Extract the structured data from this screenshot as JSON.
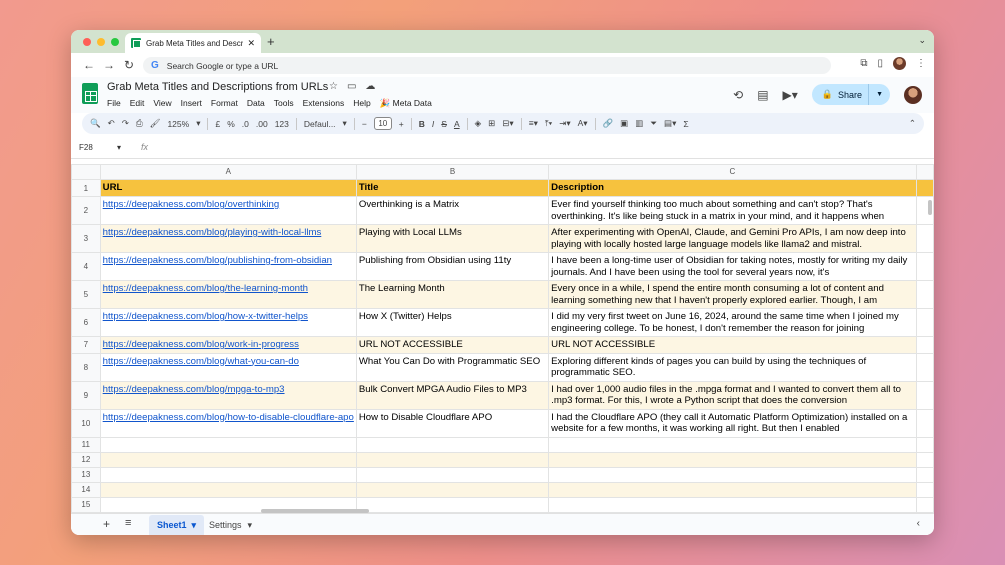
{
  "browser": {
    "tab_title": "Grab Meta Titles and Descriptio",
    "omnibox_placeholder": "Search Google or type a URL",
    "traffic_colors": [
      "#ff5f57",
      "#febc2e",
      "#28c840"
    ]
  },
  "app": {
    "doc_title": "Grab Meta Titles and Descriptions from URLs",
    "menu": [
      "File",
      "Edit",
      "View",
      "Insert",
      "Format",
      "Data",
      "Tools",
      "Extensions",
      "Help",
      "🎉 Meta Data"
    ],
    "share_label": "Share"
  },
  "toolbar": {
    "zoom": "125%",
    "currency": "£",
    "percent": "%",
    "dec_decrease": ".0",
    "dec_increase": ".00",
    "number_format": "123",
    "font": "Defaul...",
    "font_size": "10"
  },
  "formula": {
    "cell_ref": "F28",
    "fx": "fx"
  },
  "grid": {
    "columns": [
      "A",
      "B",
      "C"
    ],
    "header": {
      "url": "URL",
      "title": "Title",
      "description": "Description"
    },
    "rows": [
      {
        "n": "2",
        "url": "https://deepakness.com/blog/overthinking",
        "title": "Overthinking is a Matrix",
        "desc": "Ever find yourself thinking too much about something and can't stop? That's overthinking. It's like being stuck in a matrix in your mind, and it happens when"
      },
      {
        "n": "3",
        "url": "https://deepakness.com/blog/playing-with-local-llms",
        "title": "Playing with Local LLMs",
        "desc": "After experimenting with OpenAI, Claude, and Gemini Pro APIs, I am now deep into playing with locally hosted large language models like llama2 and mistral."
      },
      {
        "n": "4",
        "url": "https://deepakness.com/blog/publishing-from-obsidian",
        "title": "Publishing from Obsidian using 11ty",
        "desc": "I have been a long-time user of Obsidian for taking notes, mostly for writing my daily journals. And I have been using the tool for several years now, it's"
      },
      {
        "n": "5",
        "url": "https://deepakness.com/blog/the-learning-month",
        "title": "The Learning Month",
        "desc": "Every once in a while, I spend the entire month consuming a lot of content and learning something new that I haven't properly explored earlier. Though, I am"
      },
      {
        "n": "6",
        "url": "https://deepakness.com/blog/how-x-twitter-helps",
        "title": "How X (Twitter) Helps",
        "desc": "I did my very first tweet on June 16, 2024, around the same time when I joined my engineering college. To be honest, I don't remember the reason for joining"
      },
      {
        "n": "7",
        "url": "https://deepakness.com/blog/work-in-progress",
        "title": "URL NOT ACCESSIBLE",
        "desc": "URL NOT ACCESSIBLE"
      },
      {
        "n": "8",
        "url": "https://deepakness.com/blog/what-you-can-do",
        "title": "What You Can Do with Programmatic SEO",
        "desc": "Exploring different kinds of pages you can build by using the techniques of programmatic SEO."
      },
      {
        "n": "9",
        "url": "https://deepakness.com/blog/mpga-to-mp3",
        "title": "Bulk Convert MPGA Audio Files to MP3",
        "desc": "I had over 1,000 audio files in the .mpga format and I wanted to convert them all to .mp3 format. For this, I wrote a Python script that does the conversion"
      },
      {
        "n": "10",
        "url": "https://deepakness.com/blog/how-to-disable-cloudflare-apo",
        "title": "How to Disable Cloudflare APO",
        "desc": "I had the Cloudflare APO (they call it Automatic Platform Optimization) installed on a website for a few months, it was working all right. But then I enabled"
      }
    ],
    "empty_rows": [
      "11",
      "12",
      "13",
      "14",
      "15"
    ]
  },
  "sheets": {
    "active": "Sheet1",
    "other": "Settings"
  },
  "colors": {
    "header_fill": "#f6c23e",
    "band_fill": "#fdf6e3",
    "link": "#1155cc"
  }
}
